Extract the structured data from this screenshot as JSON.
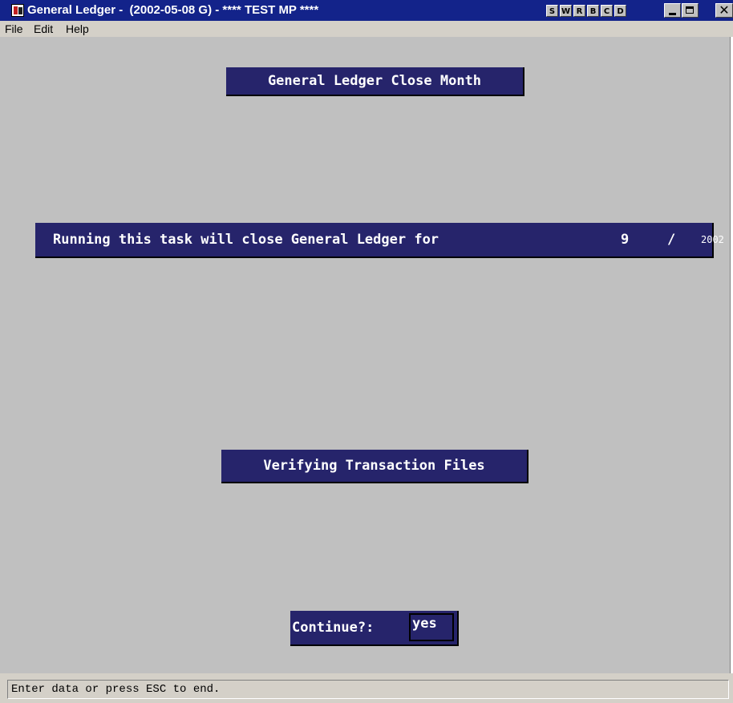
{
  "window": {
    "title": "General Ledger -  (2002-05-08 G) - **** TEST MP ****",
    "app_icon": "ledger-app-icon",
    "special_buttons": [
      "S",
      "W",
      "R",
      "B",
      "C",
      "D"
    ],
    "controls": {
      "minimize": "minimize-icon",
      "maximize": "maximize-icon",
      "close": "close-icon"
    }
  },
  "menu": {
    "items": [
      "File",
      "Edit",
      "Help"
    ]
  },
  "screen": {
    "title": "General Ledger Close Month",
    "message": "Running this task will close General Ledger for",
    "month": "9",
    "separator": "/",
    "year": "2002",
    "progress_label": "Verifying Transaction Files",
    "continue_label": "Continue?:",
    "continue_value": "yes"
  },
  "status": {
    "text": "Enter data or press ESC to end."
  },
  "colors": {
    "titlebar": "#13238a",
    "panel": "#26246b",
    "background": "#c0c0c0"
  }
}
